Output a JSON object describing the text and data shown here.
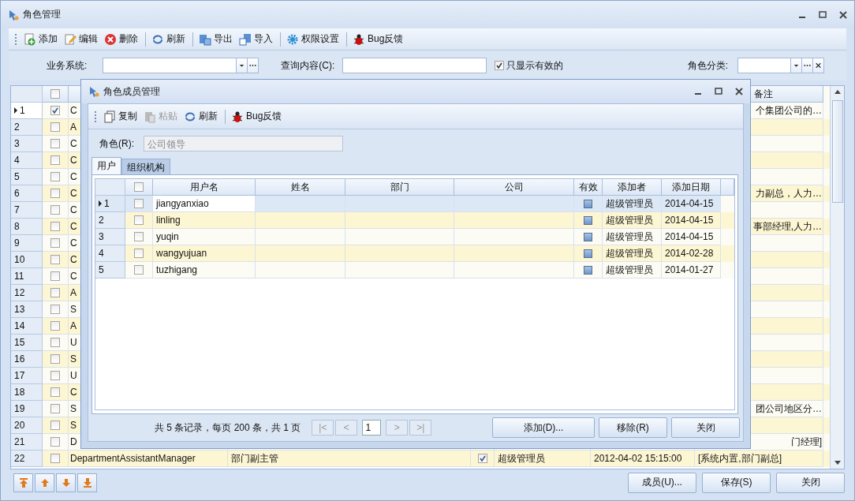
{
  "window": {
    "title": "角色管理"
  },
  "toolbar": [
    {
      "label": "添加",
      "kind": "add"
    },
    {
      "label": "编辑",
      "kind": "edit"
    },
    {
      "label": "删除",
      "kind": "delete"
    },
    {
      "label": "刷新",
      "kind": "refresh"
    },
    {
      "label": "导出",
      "kind": "export"
    },
    {
      "label": "导入",
      "kind": "import"
    },
    {
      "label": "权限设置",
      "kind": "gear"
    },
    {
      "label": "Bug反馈",
      "kind": "bug"
    }
  ],
  "filters": {
    "system_label": "业务系统:",
    "query_label": "查询内容(C):",
    "only_valid": {
      "label": "只显示有效的",
      "checked": true
    },
    "category_label": "角色分类:"
  },
  "main_table": {
    "remark_header": "备注",
    "header_checked": false,
    "rows": [
      {
        "num": "1",
        "selected": true,
        "checked": true,
        "code": "C",
        "remark": "个集团公司的…"
      },
      {
        "num": "2",
        "selected": false,
        "checked": false,
        "code": "A"
      },
      {
        "num": "3",
        "selected": false,
        "checked": false,
        "code": "C"
      },
      {
        "num": "4",
        "selected": false,
        "checked": false,
        "code": "C"
      },
      {
        "num": "5",
        "selected": false,
        "checked": false,
        "code": "C"
      },
      {
        "num": "6",
        "selected": false,
        "checked": false,
        "code": "C",
        "remark": "力副总，人力…"
      },
      {
        "num": "7",
        "selected": false,
        "checked": false,
        "code": "C"
      },
      {
        "num": "8",
        "selected": false,
        "checked": false,
        "code": "C",
        "remark": "事部经理,人力…"
      },
      {
        "num": "9",
        "selected": false,
        "checked": false,
        "code": "C"
      },
      {
        "num": "10",
        "selected": false,
        "checked": false,
        "code": "C"
      },
      {
        "num": "11",
        "selected": false,
        "checked": false,
        "code": "C"
      },
      {
        "num": "12",
        "selected": false,
        "checked": false,
        "code": "A"
      },
      {
        "num": "13",
        "selected": false,
        "checked": false,
        "code": "S"
      },
      {
        "num": "14",
        "selected": false,
        "checked": false,
        "code": "A"
      },
      {
        "num": "15",
        "selected": false,
        "checked": false,
        "code": "U"
      },
      {
        "num": "16",
        "selected": false,
        "checked": false,
        "code": "S"
      },
      {
        "num": "17",
        "selected": false,
        "checked": false,
        "code": "U"
      },
      {
        "num": "18",
        "selected": false,
        "checked": false,
        "code": "C"
      },
      {
        "num": "19",
        "selected": false,
        "checked": false,
        "code": "S",
        "remark": "团公司地区分…"
      },
      {
        "num": "20",
        "selected": false,
        "checked": false,
        "code": "S"
      },
      {
        "num": "21",
        "selected": false,
        "checked": false,
        "code": "D",
        "remark": "门经理]"
      },
      {
        "num": "22",
        "selected": false,
        "checked": false,
        "code": "DepartmentAssistantManager",
        "name": "部门副主管",
        "valid": true,
        "creator": "超级管理员",
        "date": "2012-04-02 15:15:00",
        "remark": "[系统内置,部门副总]"
      }
    ]
  },
  "bottom_buttons": [
    "成员(U)...",
    "保存(S)",
    "关闭"
  ],
  "dialog": {
    "title": "角色成员管理",
    "toolbar": [
      {
        "label": "复制",
        "kind": "copy",
        "disabled": false
      },
      {
        "label": "粘贴",
        "kind": "paste",
        "disabled": true
      },
      {
        "label": "刷新",
        "kind": "refresh",
        "disabled": false
      },
      {
        "label": "Bug反馈",
        "kind": "bug",
        "disabled": false
      }
    ],
    "role_label": "角色(R):",
    "role_value": "公司领导",
    "tabs": [
      {
        "label": "用户",
        "selected": true
      },
      {
        "label": "组织机构",
        "selected": false
      }
    ],
    "columns": [
      "用户名",
      "姓名",
      "部门",
      "公司",
      "有效",
      "添加者",
      "添加日期"
    ],
    "header_checked": false,
    "rows": [
      {
        "num": "1",
        "selected": true,
        "checked": false,
        "username": "jiangyanxiao",
        "valid": true,
        "creator": "超级管理员",
        "date": "2014-04-15"
      },
      {
        "num": "2",
        "selected": false,
        "checked": false,
        "username": "linling",
        "valid": true,
        "creator": "超级管理员",
        "date": "2014-04-15"
      },
      {
        "num": "3",
        "selected": false,
        "checked": false,
        "username": "yuqin",
        "valid": true,
        "creator": "超级管理员",
        "date": "2014-04-15"
      },
      {
        "num": "4",
        "selected": false,
        "checked": false,
        "username": "wangyujuan",
        "valid": true,
        "creator": "超级管理员",
        "date": "2014-02-28"
      },
      {
        "num": "5",
        "selected": false,
        "checked": false,
        "username": "tuzhigang",
        "valid": true,
        "creator": "超级管理员",
        "date": "2014-01-27"
      }
    ],
    "pager": {
      "summary": "共 5 条记录，每页 200 条，共 1 页",
      "first": "|<",
      "prev": "<",
      "page": "1",
      "next": ">",
      "last": ">|"
    },
    "buttons": [
      "添加(D)...",
      "移除(R)",
      "关闭"
    ]
  }
}
